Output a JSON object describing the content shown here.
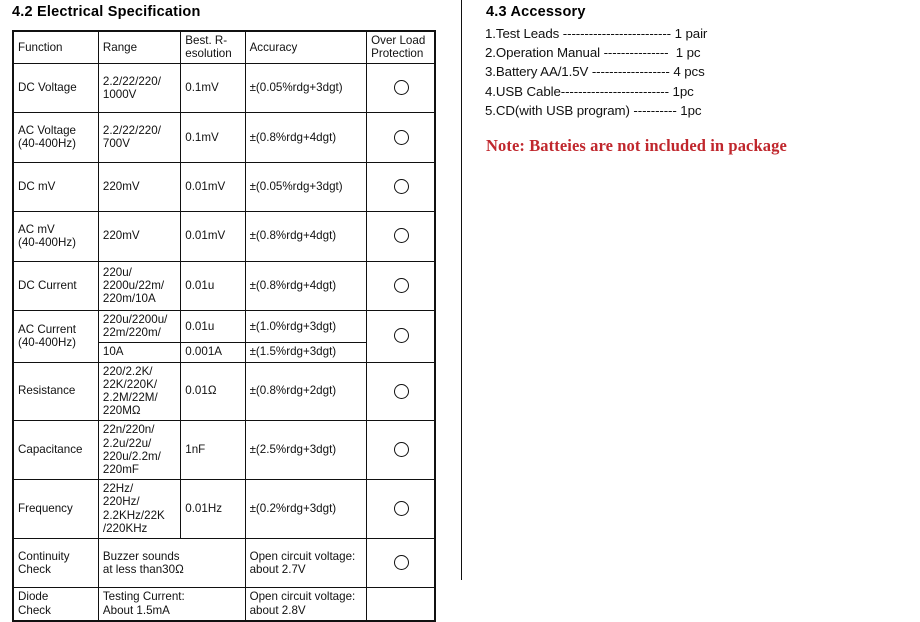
{
  "left": {
    "title": "4.2 Electrical Specification",
    "table": {
      "columns": [
        "Function",
        "Range",
        "Best. R-\nesolution",
        "Accuracy",
        "Over Load\nProtection"
      ],
      "rows": [
        {
          "function": "DC Voltage",
          "range": "2.2/22/220/\n1000V",
          "resolution": "0.1mV",
          "accuracy": "±(0.05%rdg+3dgt)",
          "overload": "circle-icon"
        },
        {
          "function": "AC Voltage\n(40-400Hz)",
          "range": "2.2/22/220/\n700V",
          "resolution": "0.1mV",
          "accuracy": "±(0.8%rdg+4dgt)",
          "overload": "circle-icon"
        },
        {
          "function": "DC mV",
          "range": "220mV",
          "resolution": "0.01mV",
          "accuracy": "±(0.05%rdg+3dgt)",
          "overload": "circle-icon"
        },
        {
          "function": "AC mV\n(40-400Hz)",
          "range": "220mV",
          "resolution": "0.01mV",
          "accuracy": "±(0.8%rdg+4dgt)",
          "overload": "circle-icon"
        },
        {
          "function": "DC Current",
          "range": "220u/\n2200u/22m/\n220m/10A",
          "resolution": "0.01u",
          "accuracy": "±(0.8%rdg+4dgt)",
          "overload": "circle-icon"
        },
        {
          "function": "AC Current\n(40-400Hz)",
          "range": "220u/2200u/\n22m/220m/",
          "resolution": "0.01u",
          "accuracy": "±(1.0%rdg+3dgt)",
          "overload": "circle-icon",
          "sub_range": "10A",
          "sub_resolution": "0.001A",
          "sub_accuracy": "±(1.5%rdg+3dgt)"
        },
        {
          "function": "Resistance",
          "range": "220/2.2K/\n22K/220K/\n2.2M/22M/\n220MΩ",
          "resolution": "0.01Ω",
          "accuracy": "±(0.8%rdg+2dgt)",
          "overload": "circle-icon"
        },
        {
          "function": "Capacitance",
          "range": "22n/220n/\n2.2u/22u/\n220u/2.2m/\n220mF",
          "resolution": "1nF",
          "accuracy": "±(2.5%rdg+3dgt)",
          "overload": "circle-icon"
        },
        {
          "function": "Frequency",
          "range": "22Hz/\n220Hz/\n2.2KHz/22K\n/220KHz",
          "resolution": "0.01Hz",
          "accuracy": "±(0.2%rdg+3dgt)",
          "overload": "circle-icon"
        },
        {
          "function": "Continuity\nCheck",
          "range": "Buzzer sounds\nat less than30Ω",
          "accuracy": "Open circuit voltage:\nabout 2.7V",
          "overload": "circle-icon"
        },
        {
          "function": "Diode\nCheck",
          "range": "Testing Current:\nAbout 1.5mA",
          "accuracy": "Open circuit voltage:\nabout 2.8V",
          "overload": ""
        }
      ]
    }
  },
  "right": {
    "title": "4.3 Accessory",
    "accessories": [
      "1.Test Leads ------------------------- 1 pair",
      "2.Operation Manual ---------------  1 pc",
      "3.Battery AA/1.5V ------------------ 4 pcs",
      "4.USB Cable------------------------- 1pc",
      "5.CD(with USB program) ---------- 1pc"
    ],
    "note": "Note: Batteies are not included in package",
    "note_color": "#c0272d"
  }
}
